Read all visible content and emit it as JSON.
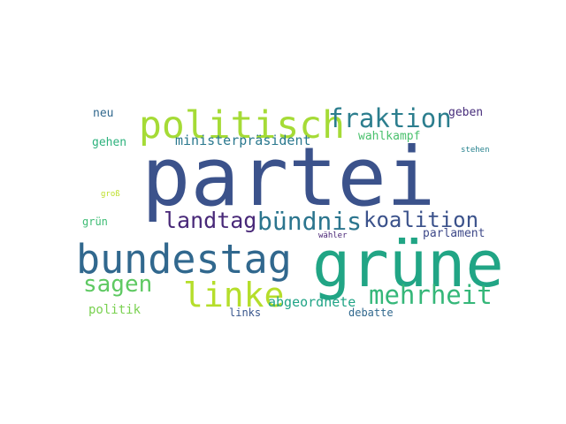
{
  "words": [
    {
      "text": "partei",
      "color": "#3b528b"
    },
    {
      "text": "grüne",
      "color": "#21a585"
    },
    {
      "text": "bundestag",
      "color": "#31688e"
    },
    {
      "text": "politisch",
      "color": "#a5db36"
    },
    {
      "text": "fraktion",
      "color": "#2c7e8e"
    },
    {
      "text": "linke",
      "color": "#b5de2b"
    },
    {
      "text": "mehrheit",
      "color": "#35b779"
    },
    {
      "text": "bündnis",
      "color": "#2b758e"
    },
    {
      "text": "koalition",
      "color": "#3b528b"
    },
    {
      "text": "landtag",
      "color": "#482878"
    },
    {
      "text": "sagen",
      "color": "#5ec962"
    },
    {
      "text": "ministerpräsident",
      "color": "#2a788e"
    },
    {
      "text": "abgeordnete",
      "color": "#20a486"
    },
    {
      "text": "parlament",
      "color": "#3e4989"
    },
    {
      "text": "wahlkampf",
      "color": "#4ac16d"
    },
    {
      "text": "politik",
      "color": "#7ad151"
    },
    {
      "text": "geben",
      "color": "#472d7b"
    },
    {
      "text": "neu",
      "color": "#31688e"
    },
    {
      "text": "gehen",
      "color": "#2db27d"
    },
    {
      "text": "grün",
      "color": "#3dbc74"
    },
    {
      "text": "links",
      "color": "#39568c"
    },
    {
      "text": "debatte",
      "color": "#31688e"
    },
    {
      "text": "stehen",
      "color": "#26828e"
    },
    {
      "text": "groß",
      "color": "#bddf26"
    },
    {
      "text": "wähler",
      "color": "#482475"
    }
  ]
}
